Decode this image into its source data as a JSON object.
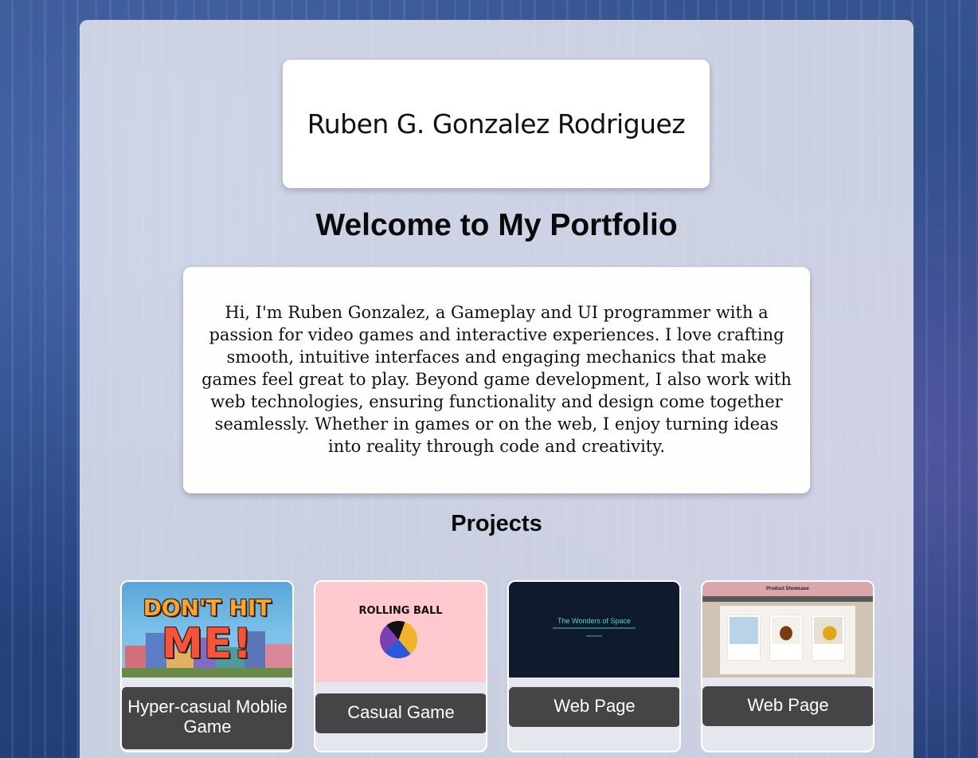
{
  "header": {
    "name": "Ruben G. Gonzalez Rodriguez"
  },
  "welcome": {
    "title": "Welcome to My Portfolio"
  },
  "about": {
    "text": "Hi, I'm Ruben Gonzalez, a Gameplay and UI programmer with a passion for video games and interactive experiences. I love crafting smooth, intuitive interfaces and engaging mechanics that make games feel great to play. Beyond game development, I also work with web technologies, ensuring functionality and design come together seamlessly. Whether in games or on the web, I enjoy turning ideas into reality through code and creativity."
  },
  "projects": {
    "title": "Projects",
    "items": [
      {
        "label": "Hyper-casual Moblie Game",
        "thumb_line1": "DON'T HIT",
        "thumb_line2": "ME!"
      },
      {
        "label": "Casual Game",
        "thumb_title": "ROLLING BALL"
      },
      {
        "label": "Web Page",
        "thumb_title": "The Wonders of Space"
      },
      {
        "label": "Web Page",
        "thumb_title": "Product Showcase"
      }
    ]
  },
  "colors": {
    "card_label_bg": "#454548",
    "card_label_text": "#ffffff",
    "container_bg": "#e4e7f0",
    "page_bg": "#2a4a86"
  }
}
